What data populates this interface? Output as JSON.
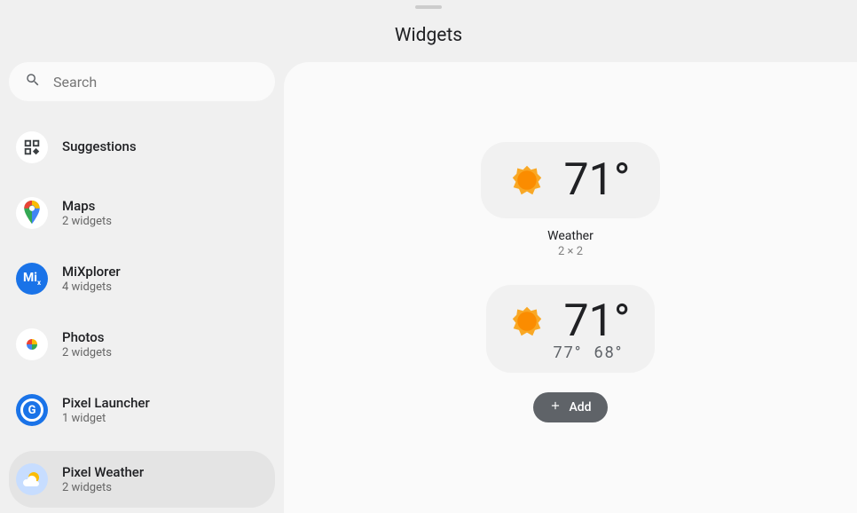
{
  "header": {
    "title": "Widgets"
  },
  "search": {
    "placeholder": "Search"
  },
  "sidebar": {
    "suggestions_label": "Suggestions",
    "items": [
      {
        "label": "Maps",
        "sub": "2 widgets"
      },
      {
        "label": "MiXplorer",
        "sub": "4 widgets"
      },
      {
        "label": "Photos",
        "sub": "2 widgets"
      },
      {
        "label": "Pixel Launcher",
        "sub": "1 widget"
      },
      {
        "label": "Pixel Weather",
        "sub": "2 widgets"
      }
    ]
  },
  "previews": {
    "w0": {
      "temp": "71°",
      "name": "Weather",
      "dim": "2 × 2"
    },
    "w1": {
      "temp": "71°",
      "high": "77°",
      "low": "68°"
    }
  },
  "add_label": "Add"
}
